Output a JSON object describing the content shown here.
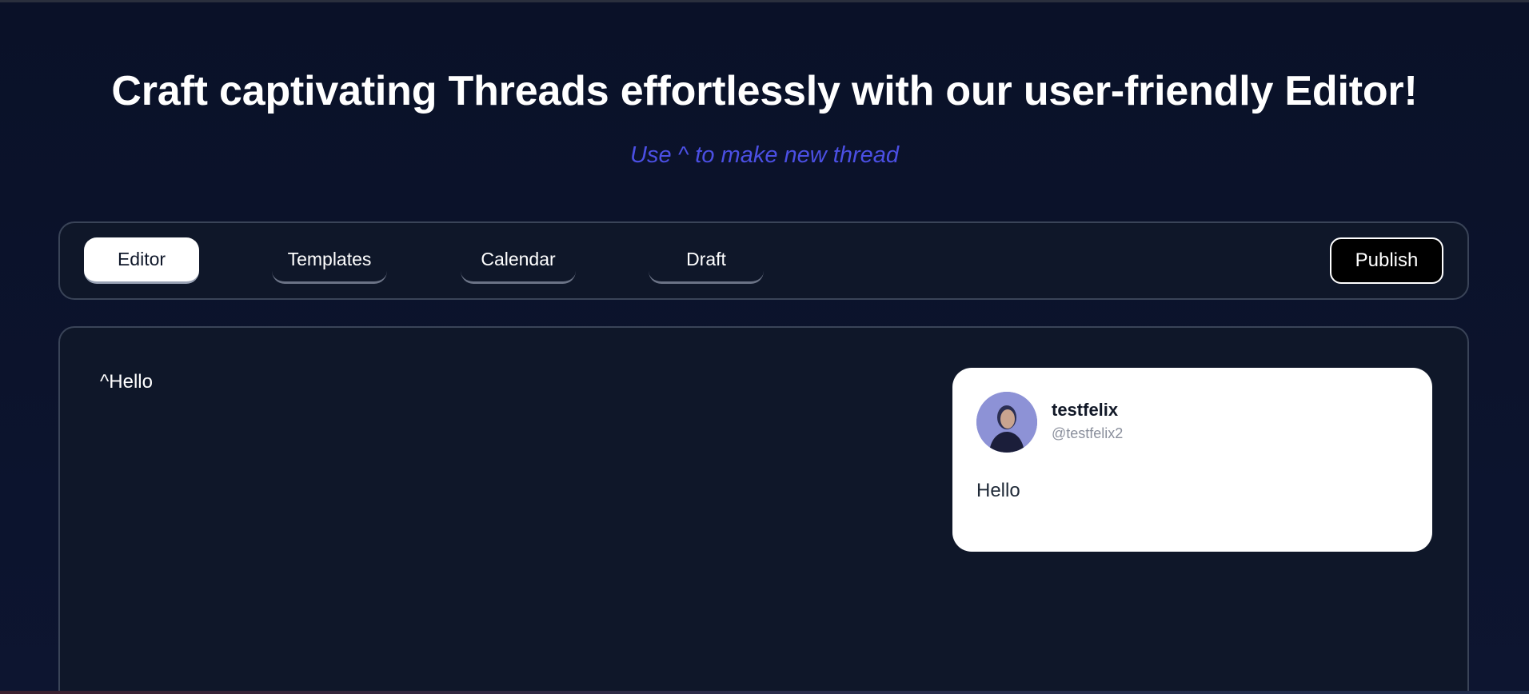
{
  "header": {
    "title": "Craft captivating Threads effortlessly with our user-friendly Editor!",
    "hint": "Use ^ to make new thread"
  },
  "tabs": [
    {
      "label": "Editor",
      "active": true
    },
    {
      "label": "Templates",
      "active": false
    },
    {
      "label": "Calendar",
      "active": false
    },
    {
      "label": "Draft",
      "active": false
    }
  ],
  "toolbar": {
    "publish_label": "Publish"
  },
  "editor": {
    "content": "^Hello"
  },
  "preview": {
    "username": "testfelix",
    "handle": "@testfelix2",
    "post_text": "Hello",
    "avatar_icon": "user-avatar-photo"
  },
  "colors": {
    "background": "#0a1128",
    "accent_hint": "#4b4fe3",
    "panel_border": "#3a4458",
    "card_bg": "#ffffff"
  }
}
